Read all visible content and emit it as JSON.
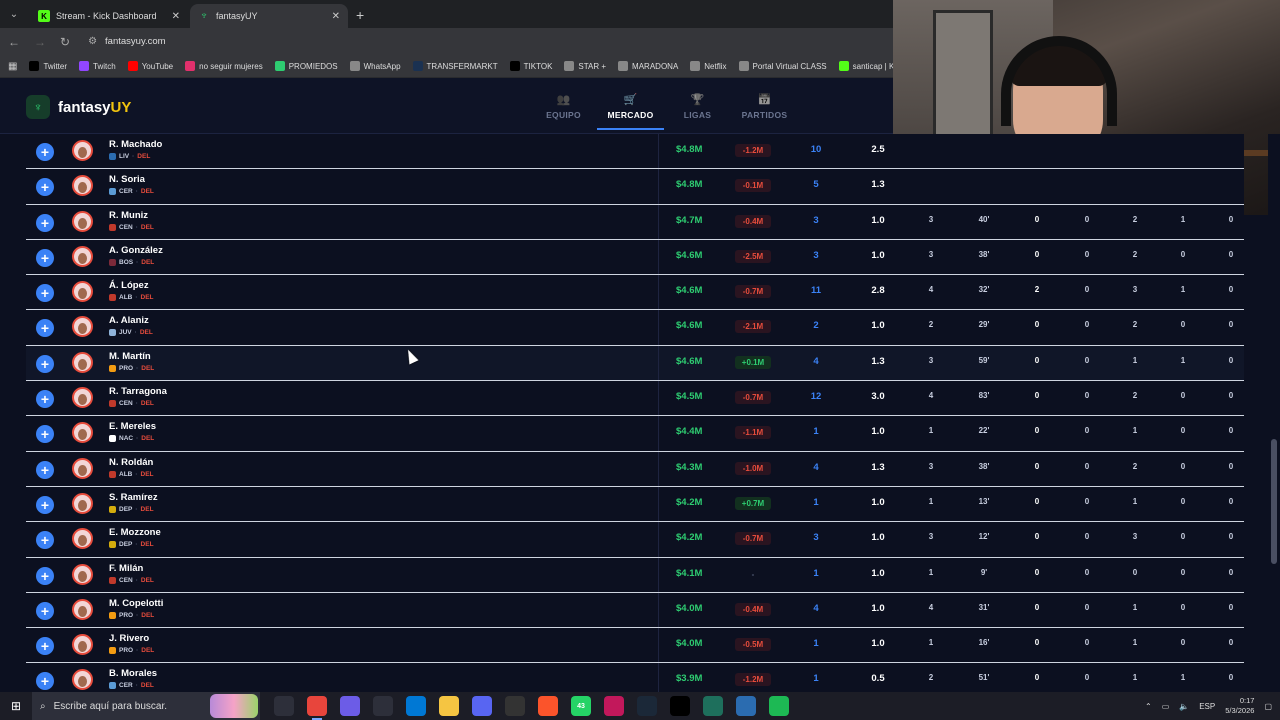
{
  "browser": {
    "tabs": [
      {
        "title": "Stream - Kick Dashboard",
        "icon": "kick-icon",
        "active": false
      },
      {
        "title": "fantasyUY",
        "icon": "trophy-icon",
        "active": true
      }
    ],
    "url": "fantasyuy.com",
    "bookmarks": [
      {
        "label": "Twitter",
        "icon": "x-icon",
        "color": "#000000"
      },
      {
        "label": "Twitch",
        "icon": "twitch-icon",
        "color": "#9146ff"
      },
      {
        "label": "YouTube",
        "icon": "youtube-icon",
        "color": "#ff0000"
      },
      {
        "label": "no seguir mujeres",
        "icon": "instagram-icon",
        "color": "#e1306c"
      },
      {
        "label": "PROMIEDOS",
        "icon": "promiedos-icon",
        "color": "#2ecc71"
      },
      {
        "label": "WhatsApp",
        "icon": "globe-icon",
        "color": "#888888"
      },
      {
        "label": "TRANSFERMARKT",
        "icon": "transfermarkt-icon",
        "color": "#1a3151"
      },
      {
        "label": "TIKTOK",
        "icon": "tiktok-icon",
        "color": "#000000"
      },
      {
        "label": "STAR +",
        "icon": "globe-icon",
        "color": "#888888"
      },
      {
        "label": "MARADONA",
        "icon": "globe-icon",
        "color": "#888888"
      },
      {
        "label": "Netflix",
        "icon": "globe-icon",
        "color": "#888888"
      },
      {
        "label": "Portal Virtual CLASS",
        "icon": "globe-icon",
        "color": "#888888"
      },
      {
        "label": "santicap | Kick",
        "icon": "kick-icon",
        "color": "#53fc18"
      }
    ]
  },
  "app": {
    "logo_main": "fantasy",
    "logo_accent": "UY",
    "nav": [
      {
        "label": "EQUIPO",
        "icon": "team-icon",
        "active": false
      },
      {
        "label": "MERCADO",
        "icon": "cart-icon",
        "active": true
      },
      {
        "label": "LIGAS",
        "icon": "trophy-icon",
        "active": false
      },
      {
        "label": "PARTIDOS",
        "icon": "calendar-icon",
        "active": false
      }
    ]
  },
  "players": [
    {
      "name": "R. Machado",
      "club": "LIV",
      "pos": "DEL",
      "price": "$4.8M",
      "change": "-1.2M",
      "trend": "neg",
      "pts": "10",
      "avg": "2.5",
      "pj": "",
      "min": "",
      "g": "",
      "a": "",
      "ta": "",
      "tr": "",
      "x": ""
    },
    {
      "name": "N. Soria",
      "club": "CER",
      "pos": "DEL",
      "price": "$4.8M",
      "change": "-0.1M",
      "trend": "neg",
      "pts": "5",
      "avg": "1.3",
      "pj": "",
      "min": "",
      "g": "",
      "a": "",
      "ta": "",
      "tr": "",
      "x": ""
    },
    {
      "name": "R. Muniz",
      "club": "CEN",
      "pos": "DEL",
      "price": "$4.7M",
      "change": "-0.4M",
      "trend": "neg",
      "pts": "3",
      "avg": "1.0",
      "pj": "3",
      "min": "40'",
      "g": "0",
      "a": "0",
      "ta": "2",
      "tr": "1",
      "x": "0"
    },
    {
      "name": "A. González",
      "club": "BOS",
      "pos": "DEL",
      "price": "$4.6M",
      "change": "-2.5M",
      "trend": "neg",
      "pts": "3",
      "avg": "1.0",
      "pj": "3",
      "min": "38'",
      "g": "0",
      "a": "0",
      "ta": "2",
      "tr": "0",
      "x": "0"
    },
    {
      "name": "Á. López",
      "club": "ALB",
      "pos": "DEL",
      "price": "$4.6M",
      "change": "-0.7M",
      "trend": "neg",
      "pts": "11",
      "avg": "2.8",
      "pj": "4",
      "min": "32'",
      "g": "2",
      "a": "0",
      "ta": "3",
      "tr": "1",
      "x": "0"
    },
    {
      "name": "A. Alaniz",
      "club": "JUV",
      "pos": "DEL",
      "price": "$4.6M",
      "change": "-2.1M",
      "trend": "neg",
      "pts": "2",
      "avg": "1.0",
      "pj": "2",
      "min": "29'",
      "g": "0",
      "a": "0",
      "ta": "2",
      "tr": "0",
      "x": "0"
    },
    {
      "name": "M. Martín",
      "club": "PRO",
      "pos": "DEL",
      "price": "$4.6M",
      "change": "+0.1M",
      "trend": "pos",
      "pts": "4",
      "avg": "1.3",
      "pj": "3",
      "min": "59'",
      "g": "0",
      "a": "0",
      "ta": "1",
      "tr": "1",
      "x": "0"
    },
    {
      "name": "R. Tarragona",
      "club": "CEN",
      "pos": "DEL",
      "price": "$4.5M",
      "change": "-0.7M",
      "trend": "neg",
      "pts": "12",
      "avg": "3.0",
      "pj": "4",
      "min": "83'",
      "g": "0",
      "a": "0",
      "ta": "2",
      "tr": "0",
      "x": "0"
    },
    {
      "name": "E. Mereles",
      "club": "NAC",
      "pos": "DEL",
      "price": "$4.4M",
      "change": "-1.1M",
      "trend": "neg",
      "pts": "1",
      "avg": "1.0",
      "pj": "1",
      "min": "22'",
      "g": "0",
      "a": "0",
      "ta": "1",
      "tr": "0",
      "x": "0"
    },
    {
      "name": "N. Roldán",
      "club": "ALB",
      "pos": "DEL",
      "price": "$4.3M",
      "change": "-1.0M",
      "trend": "neg",
      "pts": "4",
      "avg": "1.3",
      "pj": "3",
      "min": "38'",
      "g": "0",
      "a": "0",
      "ta": "2",
      "tr": "0",
      "x": "0"
    },
    {
      "name": "S. Ramírez",
      "club": "DEP",
      "pos": "DEL",
      "price": "$4.2M",
      "change": "+0.7M",
      "trend": "pos",
      "pts": "1",
      "avg": "1.0",
      "pj": "1",
      "min": "13'",
      "g": "0",
      "a": "0",
      "ta": "1",
      "tr": "0",
      "x": "0"
    },
    {
      "name": "E. Mozzone",
      "club": "DEP",
      "pos": "DEL",
      "price": "$4.2M",
      "change": "-0.7M",
      "trend": "neg",
      "pts": "3",
      "avg": "1.0",
      "pj": "3",
      "min": "12'",
      "g": "0",
      "a": "0",
      "ta": "3",
      "tr": "0",
      "x": "0"
    },
    {
      "name": "F. Milán",
      "club": "CEN",
      "pos": "DEL",
      "price": "$4.1M",
      "change": "-",
      "trend": "none",
      "pts": "1",
      "avg": "1.0",
      "pj": "1",
      "min": "9'",
      "g": "0",
      "a": "0",
      "ta": "0",
      "tr": "0",
      "x": "0"
    },
    {
      "name": "M. Copelotti",
      "club": "PRO",
      "pos": "DEL",
      "price": "$4.0M",
      "change": "-0.4M",
      "trend": "neg",
      "pts": "4",
      "avg": "1.0",
      "pj": "4",
      "min": "31'",
      "g": "0",
      "a": "0",
      "ta": "1",
      "tr": "0",
      "x": "0"
    },
    {
      "name": "J. Rivero",
      "club": "PRO",
      "pos": "DEL",
      "price": "$4.0M",
      "change": "-0.5M",
      "trend": "neg",
      "pts": "1",
      "avg": "1.0",
      "pj": "1",
      "min": "16'",
      "g": "0",
      "a": "0",
      "ta": "1",
      "tr": "0",
      "x": "0"
    },
    {
      "name": "B. Morales",
      "club": "CER",
      "pos": "DEL",
      "price": "$3.9M",
      "change": "-1.2M",
      "trend": "neg",
      "pts": "1",
      "avg": "0.5",
      "pj": "2",
      "min": "51'",
      "g": "0",
      "a": "0",
      "ta": "1",
      "tr": "1",
      "x": "0"
    }
  ],
  "club_colors": {
    "LIV": "#2b6cb0",
    "CER": "#5b9bd5",
    "CEN": "#c0392b",
    "BOS": "#7d2a3a",
    "ALB": "#c0392b",
    "JUV": "#8fb3d9",
    "PRO": "#f39c12",
    "NAC": "#ffffff",
    "DEP": "#d4ac0d"
  },
  "taskbar": {
    "search_placeholder": "Escribe aquí para buscar.",
    "apps": [
      {
        "icon": "task-view-icon",
        "label": "",
        "color": "#2d2f3a"
      },
      {
        "icon": "chrome-icon",
        "label": "",
        "color": "#e8453c",
        "active": true
      },
      {
        "icon": "copilot-icon",
        "label": "",
        "color": "#6c5ce7"
      },
      {
        "icon": "calculator-icon",
        "label": "",
        "color": "#2d2f3a"
      },
      {
        "icon": "mail-icon",
        "label": "",
        "color": "#0078d4"
      },
      {
        "icon": "folder-icon",
        "label": "",
        "color": "#f5c542"
      },
      {
        "icon": "discord-icon",
        "label": "",
        "color": "#5865f2"
      },
      {
        "icon": "obs-icon",
        "label": "",
        "color": "#333333"
      },
      {
        "icon": "brave-icon",
        "label": "",
        "color": "#fb542b"
      },
      {
        "icon": "whatsapp-icon",
        "label": "43",
        "color": "#25d366"
      },
      {
        "icon": "app-icon",
        "label": "",
        "color": "#c2185b"
      },
      {
        "icon": "steam-icon",
        "label": "",
        "color": "#1b2838"
      },
      {
        "icon": "capcut-icon",
        "label": "",
        "color": "#000000"
      },
      {
        "icon": "terminal-icon",
        "label": "",
        "color": "#1e6f5c"
      },
      {
        "icon": "vpn-icon",
        "label": "",
        "color": "#2b6cb0"
      },
      {
        "icon": "spotify-icon",
        "label": "",
        "color": "#1db954"
      }
    ],
    "lang": "ESP",
    "time": "0:17",
    "date": "5/3/2026"
  }
}
